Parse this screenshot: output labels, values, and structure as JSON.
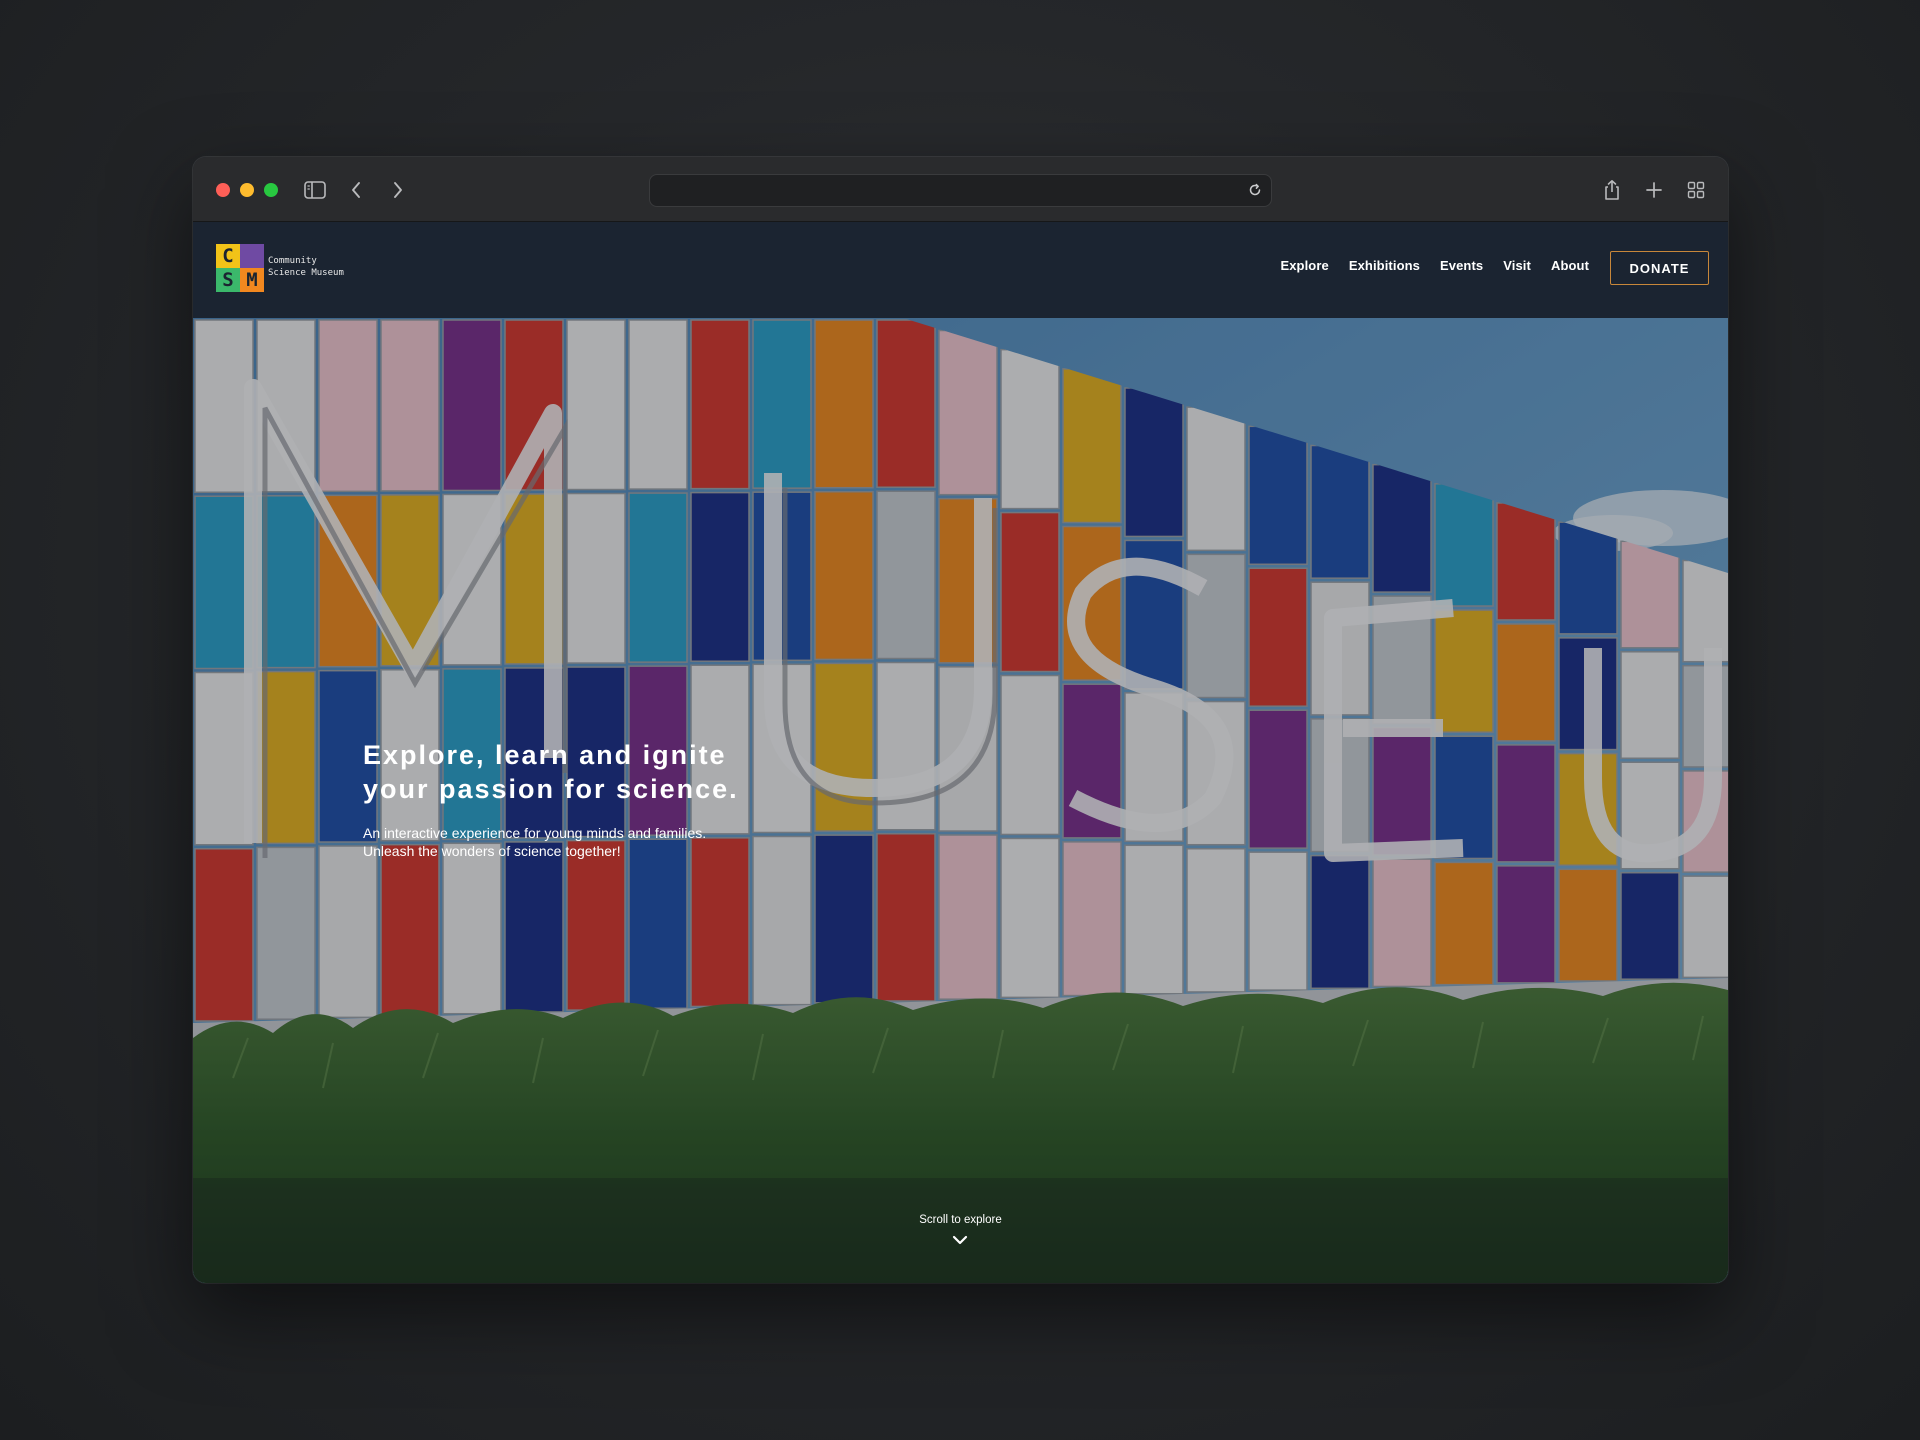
{
  "browser": {
    "url": "",
    "icons": [
      "sidebar-icon",
      "back-icon",
      "forward-icon",
      "reload-icon",
      "share-icon",
      "new-tab-icon",
      "tab-overview-icon"
    ]
  },
  "site": {
    "logo": {
      "letters": [
        "C",
        "",
        "S",
        "M"
      ],
      "line1": "Community",
      "line2": "Science Museum",
      "colors": [
        "#f2c318",
        "#6f4aa3",
        "#3bb86b",
        "#f2881f"
      ]
    },
    "nav": [
      {
        "label": "Explore"
      },
      {
        "label": "Exhibitions"
      },
      {
        "label": "Events"
      },
      {
        "label": "Visit"
      },
      {
        "label": "About"
      }
    ],
    "donate_label": "DONATE",
    "accent": "#c8873a"
  },
  "hero": {
    "title_line1": "Explore, learn and ignite",
    "title_line2": "your passion for science.",
    "subtitle_line1": "An interactive experience for young minds and families.",
    "subtitle_line2": "Unleash the wonders of science together!",
    "scroll_label": "Scroll to explore",
    "image_subject": "colorful museum building facade with large MUSEUM letters"
  }
}
